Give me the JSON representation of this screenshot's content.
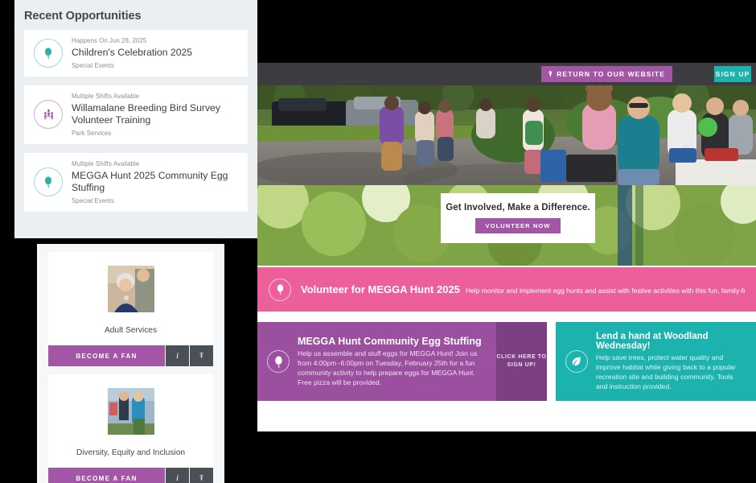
{
  "app": {
    "topbar": {
      "return_website_label": "RETURN TO OUR WEBSITE",
      "return_website_icon": "share-external-icon",
      "signup_label": "SIGN UP",
      "background_color": "#3c3c41",
      "return_button_color": "#a356a5",
      "signup_button_color": "#1cb2ad"
    },
    "hero": {
      "photo_alt": "Community volunteer fair outdoors with people, tables and a bear mascot",
      "cta_headline": "Get Involved, Make a Difference.",
      "cta_button_label": "VOLUNTEER NOW",
      "cta_button_color": "#a356a5"
    },
    "pink_banner": {
      "icon": "balloon-icon",
      "title": "Volunteer for MEGGA Hunt 2025",
      "description": "Help monitor and implement egg hunts and assist with festive activities with this fun, family-friendly opportunity!",
      "background_color": "#ec5f9b"
    },
    "purple_card": {
      "icon": "balloon-icon",
      "title": "MEGGA Hunt Community Egg Stuffing",
      "description": "Help us assemble and stuff eggs for MEGGA Hunt! Join us from 4:00pm -6:00pm on Tuesday, February 25th for a fun community activity to help prepare eggs for MEGGA Hunt. Free pizza will be provided.",
      "signup_label": "CLICK HERE TO SIGN UP!",
      "background_color": "#9b4f9f",
      "signup_color": "#7d3f84"
    },
    "teal_card": {
      "icon": "leaf-icon",
      "title": "Lend a hand at Woodland Wednesday!",
      "description": "Help save trees, protect water quality and improve habitat while giving back to a popular recreation site and building community. Tools and instruction provided.",
      "background_color": "#1cb2ad"
    }
  },
  "recent_opportunities": {
    "title": "Recent Opportunities",
    "items": [
      {
        "icon": "balloon-icon",
        "icon_color": "#2bb3a8",
        "meta": "Happens On Jun 28, 2025",
        "name": "Children's Celebration 2025",
        "category": "Special Events"
      },
      {
        "icon": "people-group-icon",
        "icon_color": "#a356a5",
        "meta": "Multiple Shifts Available",
        "name": "Willamalane Breeding Bird Survey Volunteer Training",
        "category": "Park Services"
      },
      {
        "icon": "balloon-icon",
        "icon_color": "#2bb3a8",
        "meta": "Multiple Shifts Available",
        "name": "MEGGA Hunt 2025 Community Egg Stuffing",
        "category": "Special Events"
      }
    ]
  },
  "fan_panel": {
    "cards": [
      {
        "thumbnail_alt": "Photo of two older adults smiling indoors",
        "name": "Adult Services",
        "fan_label": "BECOME A FAN",
        "info_icon": "info-italic-icon",
        "share_icon": "share-external-icon"
      },
      {
        "thumbnail_alt": "Photo of two volunteers outdoors at an event",
        "name": "Diversity, Equity and Inclusion",
        "fan_label": "BECOME A FAN",
        "info_icon": "info-italic-icon",
        "share_icon": "share-external-icon"
      }
    ],
    "button_color": "#a356a5",
    "icon_button_color": "#4b5057"
  }
}
